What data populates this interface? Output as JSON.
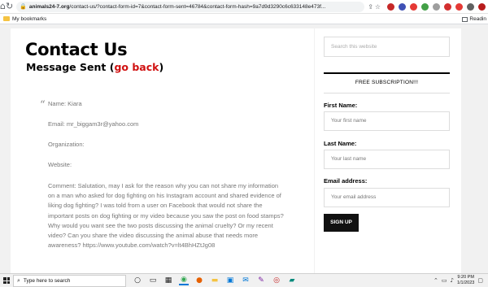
{
  "browser": {
    "url_host": "animals24-7.org",
    "url_path": "/contact-us/?contact-form-id=7&contact-form-sent=46784&contact-form-hash=9a7d9d3290c6c633148e473f...",
    "bookmarks_folder": "My bookmarks",
    "reading_list": "Readin"
  },
  "page": {
    "title": "Contact Us",
    "message_prefix": "Message Sent (",
    "go_back": "go back",
    "message_suffix": ")",
    "fields": {
      "name": "Name: Kiara",
      "email": "Email: mr_biggam3r@yahoo.com",
      "organization": "Organization:",
      "website": "Website:",
      "comment": "Comment: Salutation, may I ask for the reason why you can not share my information on a man who asked for dog fighting on his Instagram account and shared evidence of liking dog fighting? I was told from a user on Facebook that would not share the important posts on dog fighting or my video because you saw the post on food stamps? Why would you want see the two posts discussing the animal cruelty? Or my recent video? Can you share the video discussing the animal abuse that needs more awareness? https://www.youtube.com/watch?v=lt4BhHZtJg08"
    }
  },
  "sidebar": {
    "search_placeholder": "Search this website",
    "subscription_heading": "FREE SUBSCRIPTION!!!",
    "first_name_label": "First Name:",
    "first_name_placeholder": "Your first name",
    "last_name_label": "Last Name:",
    "last_name_placeholder": "Your last name",
    "email_label": "Email address:",
    "email_placeholder": "Your email address",
    "signup_label": "SIGN UP"
  },
  "taskbar": {
    "search_placeholder": "Type here to search",
    "time": "9:20 PM",
    "date": "1/1/2023"
  },
  "colors": {
    "link_red": "#d01010",
    "signup_bg": "#111111"
  }
}
